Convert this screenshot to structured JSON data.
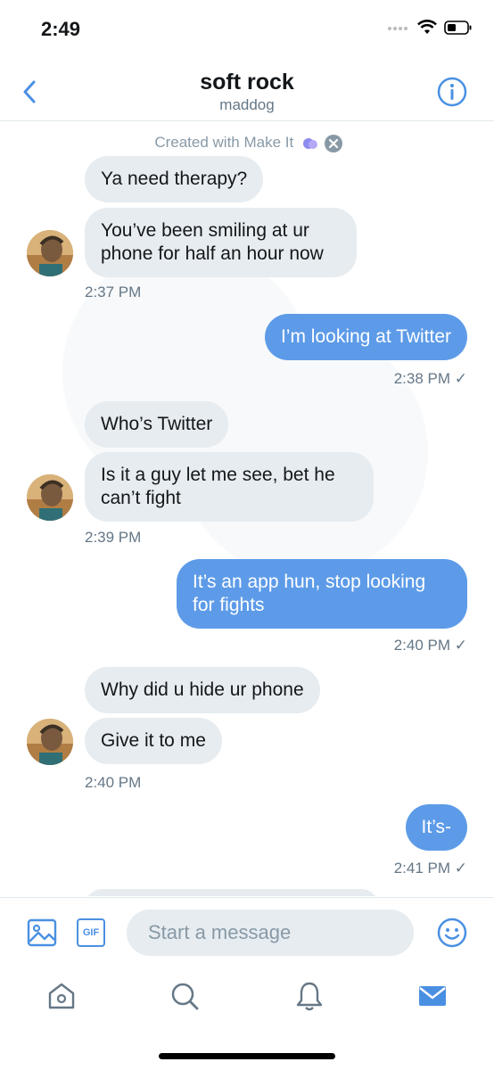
{
  "status": {
    "time": "2:49"
  },
  "header": {
    "title": "soft rock",
    "subtitle": "maddog"
  },
  "watermark": "Created with Make It",
  "messages": [
    {
      "text": "Ya need therapy?"
    },
    {
      "text": "You’ve been smiling at ur phone for half an hour now"
    },
    {
      "time": "2:37 PM"
    },
    {
      "text": "I’m looking at Twitter"
    },
    {
      "time": "2:38 PM ✓"
    },
    {
      "text": "Who’s Twitter"
    },
    {
      "text": "Is it a guy let me see, bet he can’t fight"
    },
    {
      "time": "2:39 PM"
    },
    {
      "text": "It’s an app hun, stop looking for fights"
    },
    {
      "time": "2:40 PM ✓"
    },
    {
      "text": "Why did u hide ur phone"
    },
    {
      "text": "Give it to me"
    },
    {
      "time": "2:40 PM"
    },
    {
      "text": "It’s-"
    },
    {
      "time": "2:41 PM ✓"
    }
  ],
  "composer": {
    "placeholder": "Start a message",
    "gif_label": "GIF"
  },
  "colors": {
    "accent": "#4a90e2",
    "outgoing": "#5d9be8",
    "incoming": "#e6ecf0"
  },
  "icons": [
    "chevron-left-icon",
    "info-icon",
    "image-icon",
    "gif-icon",
    "emoji-icon",
    "home-icon",
    "search-icon",
    "bell-icon",
    "mail-icon",
    "wifi-icon",
    "battery-icon"
  ]
}
